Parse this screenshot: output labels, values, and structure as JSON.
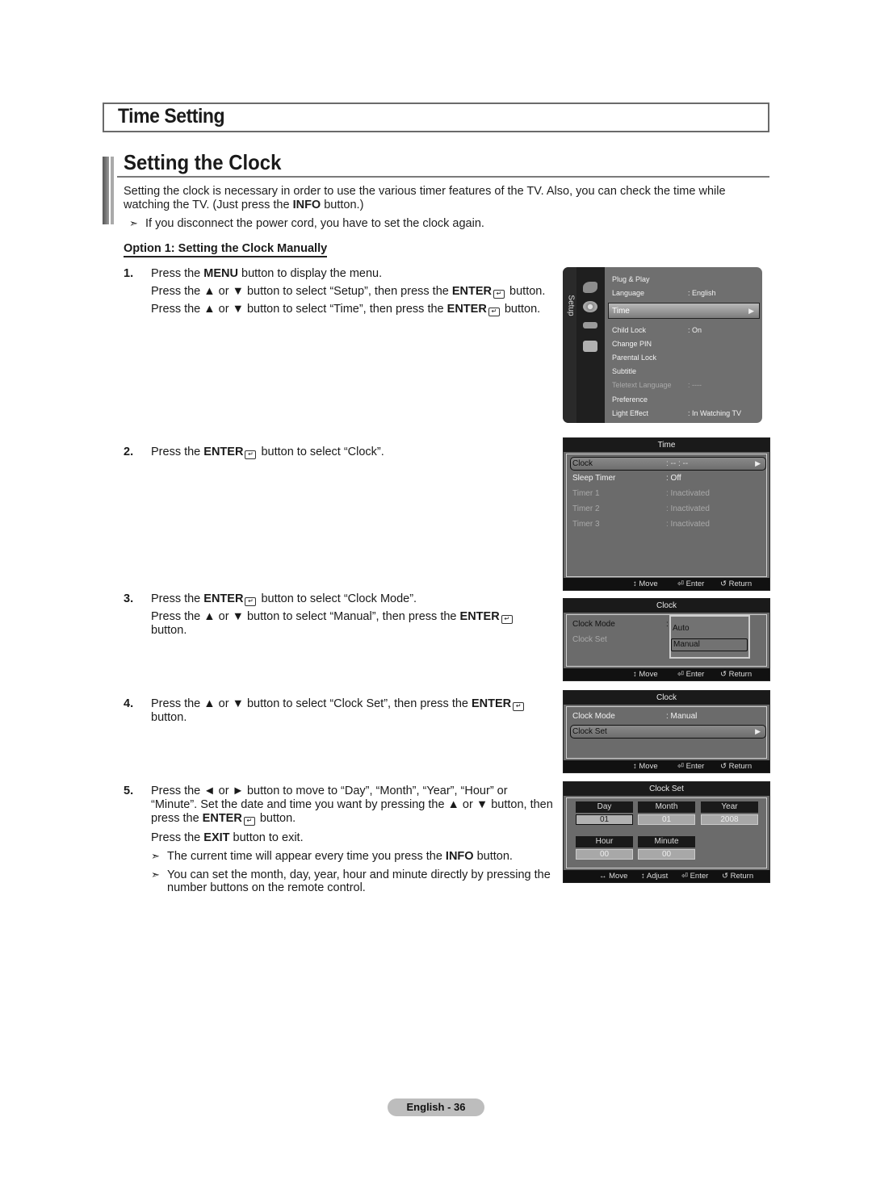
{
  "section_title": "Time Setting",
  "subsection_title": "Setting the Clock",
  "intro": {
    "line1": "Setting the clock is necessary in order to use the various timer features of the TV. Also, you can check the time while",
    "line2_pre": "watching the TV. (Just press the ",
    "line2_bold": "INFO",
    "line2_post": " button.)",
    "note": "If you disconnect the power cord, you have to set the clock again."
  },
  "option_title": "Option 1: Setting the Clock Manually",
  "steps": [
    {
      "num": "1.",
      "lines": [
        {
          "pre": "Press the ",
          "bold": "MENU",
          "post": " button to display the menu."
        },
        {
          "pre": "Press the ▲ or ▼ button to select “Setup”, then press the ",
          "bold": "ENTER",
          "post": " button."
        },
        {
          "pre": "Press the ▲ or ▼ button to select “Time”, then press the ",
          "bold": "ENTER",
          "post": " button."
        }
      ]
    },
    {
      "num": "2.",
      "lines": [
        {
          "pre": "Press the ",
          "bold": "ENTER",
          "post": " button to select “Clock”."
        }
      ]
    },
    {
      "num": "3.",
      "lines": [
        {
          "pre": "Press the ",
          "bold": "ENTER",
          "post": " button to select “Clock Mode”."
        },
        {
          "pre": "Press the ▲ or ▼ button to select “Manual”, then press the ",
          "bold": "ENTER",
          "post": ""
        },
        {
          "pre": "button.",
          "bold": "",
          "post": ""
        }
      ]
    },
    {
      "num": "4.",
      "lines": [
        {
          "pre": "Press the ▲ or ▼ button to select “Clock Set”, then press the ",
          "bold": "ENTER",
          "post": ""
        },
        {
          "pre": "button.",
          "bold": "",
          "post": ""
        }
      ]
    },
    {
      "num": "5.",
      "lines": [
        {
          "pre": "Press the ◄ or ► button to move to “Day”, “Month”, “Year”, “Hour” or",
          "bold": "",
          "post": ""
        },
        {
          "pre": "“Minute”. Set the date and time you want by pressing the ▲ or ▼ button, then",
          "bold": "",
          "post": ""
        },
        {
          "pre": "press the ",
          "bold": "ENTER",
          "post": " button."
        },
        {
          "pre": "Press the ",
          "bold": "EXIT",
          "post": " button to exit."
        }
      ],
      "notes": [
        {
          "pre": "The current time will appear every time you press the ",
          "bold": "INFO",
          "post": " button."
        },
        {
          "pre": "You can set the month, day, year, hour and minute directly by pressing the",
          "bold": "",
          "post": ""
        },
        {
          "pre": "number buttons on the remote control.",
          "bold": "",
          "post": ""
        }
      ]
    }
  ],
  "setup_menu": {
    "side_label": "Setup",
    "items": [
      {
        "label": "Plug & Play",
        "value": ""
      },
      {
        "label": "Language",
        "value": ": English"
      },
      {
        "label": "Time",
        "value": "",
        "selected": true
      },
      {
        "label": "Child Lock",
        "value": ": On"
      },
      {
        "label": "Change PIN",
        "value": ""
      },
      {
        "label": "Parental Lock",
        "value": ""
      },
      {
        "label": "Subtitle",
        "value": ""
      },
      {
        "label": "Teletext Language",
        "value": ": ----",
        "disabled": true
      },
      {
        "label": "Preference",
        "value": ""
      },
      {
        "label": "Light Effect",
        "value": ": In Watching TV"
      }
    ]
  },
  "time_menu": {
    "title": "Time",
    "items": [
      {
        "label": "Clock",
        "value": ": -- : --",
        "selected": true
      },
      {
        "label": "Sleep Timer",
        "value": ": Off"
      },
      {
        "label": "Timer 1",
        "value": ": Inactivated",
        "disabled": true
      },
      {
        "label": "Timer 2",
        "value": ": Inactivated",
        "disabled": true
      },
      {
        "label": "Timer 3",
        "value": ": Inactivated",
        "disabled": true
      }
    ]
  },
  "clock_mode_menu": {
    "title": "Clock",
    "items": [
      {
        "label": "Clock Mode",
        "value": ":"
      },
      {
        "label": "Clock Set",
        "value": "",
        "disabled": true
      }
    ],
    "dropdown_options": [
      "Auto",
      "Manual"
    ],
    "dropdown_selected": "Manual"
  },
  "clock_set_menu": {
    "title": "Clock",
    "items": [
      {
        "label": "Clock Mode",
        "value": ": Manual"
      },
      {
        "label": "Clock Set",
        "value": "",
        "selected": true
      }
    ]
  },
  "clockset_panel": {
    "title": "Clock Set",
    "fields": [
      {
        "label": "Day",
        "value": "01",
        "active": true
      },
      {
        "label": "Month",
        "value": "01"
      },
      {
        "label": "Year",
        "value": "2008"
      },
      {
        "label": "Hour",
        "value": "00"
      },
      {
        "label": "Minute",
        "value": "00"
      }
    ]
  },
  "footer_hints": {
    "move": "Move",
    "adjust": "Adjust",
    "enter": "Enter",
    "return": "Return"
  },
  "page_label": "English - 36",
  "icons": {
    "note_arrow": "➣",
    "triangle_right": "▶",
    "up_down": "↕",
    "left_right": "↔",
    "return": "↺"
  }
}
